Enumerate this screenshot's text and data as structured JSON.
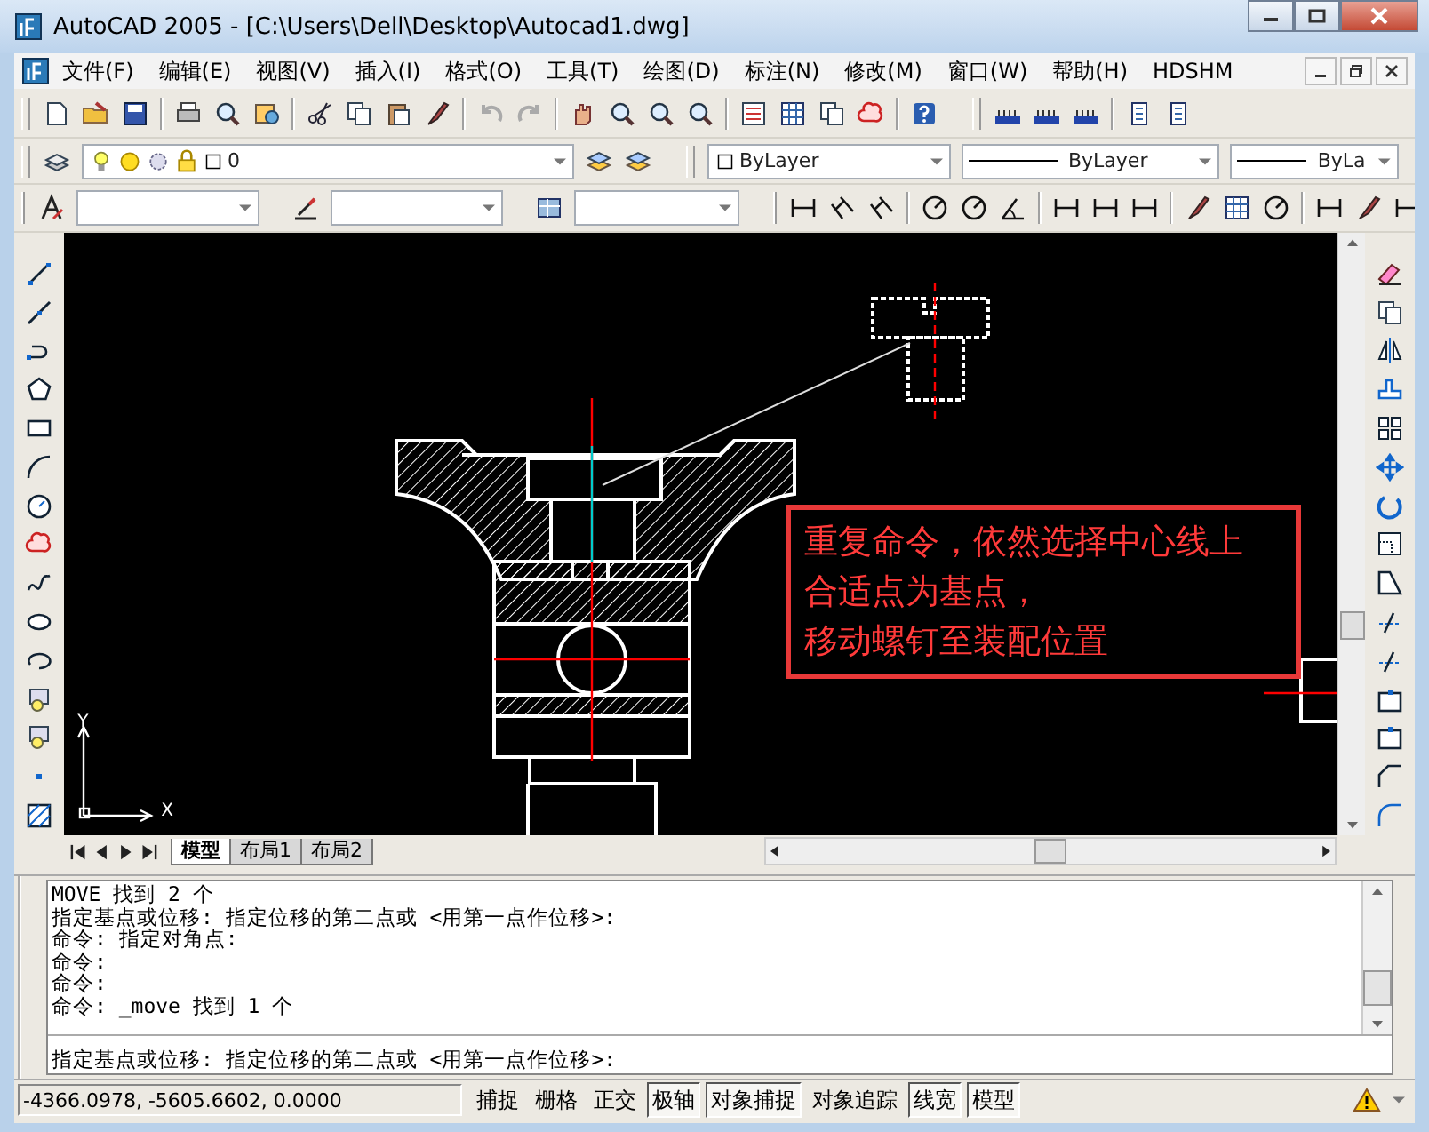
{
  "window": {
    "title": "AutoCAD 2005 - [C:\\Users\\Dell\\Desktop\\Autocad1.dwg]"
  },
  "menu": [
    "文件(F)",
    "编辑(E)",
    "视图(V)",
    "插入(I)",
    "格式(O)",
    "工具(T)",
    "绘图(D)",
    "标注(N)",
    "修改(M)",
    "窗口(W)",
    "帮助(H)",
    "HDSHM"
  ],
  "properties_toolbar": {
    "layer": "0",
    "color_setting": "ByLayer",
    "linetype": "ByLayer",
    "lineweight": "ByLa"
  },
  "annotation": {
    "lines": [
      "重复命令，依然选择中心线上",
      "合适点为基点，",
      "移动螺钉至装配位置"
    ]
  },
  "ucs": {
    "x_label": "X",
    "y_label": "Y"
  },
  "tabs": [
    {
      "label": "模型",
      "selected": true
    },
    {
      "label": "布局1",
      "selected": false
    },
    {
      "label": "布局2",
      "selected": false
    }
  ],
  "command_history": [
    "MOVE 找到 2 个",
    "指定基点或位移: 指定位移的第二点或 <用第一点作位移>:",
    "命令: 指定对角点:",
    "命令:",
    "命令:",
    "命令: _move 找到 1 个"
  ],
  "command_line": "指定基点或位移: 指定位移的第二点或 <用第一点作位移>:",
  "status_bar": {
    "coordinates": "-4366.0978, -5605.6602, 0.0000",
    "toggles": [
      {
        "label": "捕捉",
        "on": false
      },
      {
        "label": "栅格",
        "on": false
      },
      {
        "label": "正交",
        "on": false
      },
      {
        "label": "极轴",
        "on": true
      },
      {
        "label": "对象捕捉",
        "on": true
      },
      {
        "label": "对象追踪",
        "on": false
      },
      {
        "label": "线宽",
        "on": true
      },
      {
        "label": "模型",
        "on": true
      }
    ]
  }
}
